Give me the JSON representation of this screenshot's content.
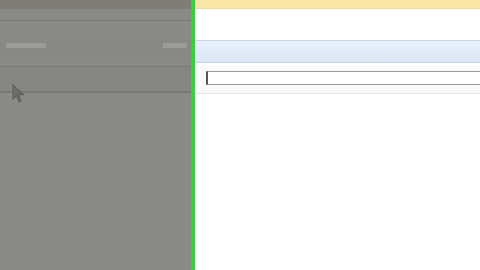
{
  "colors": {
    "left_panel": "#8a8a88",
    "divider": "#35d23c",
    "header_strip": "#fbe7a8",
    "toolbar": "#dbe7f6"
  },
  "icons": [
    "mouse-cursor-icon"
  ]
}
